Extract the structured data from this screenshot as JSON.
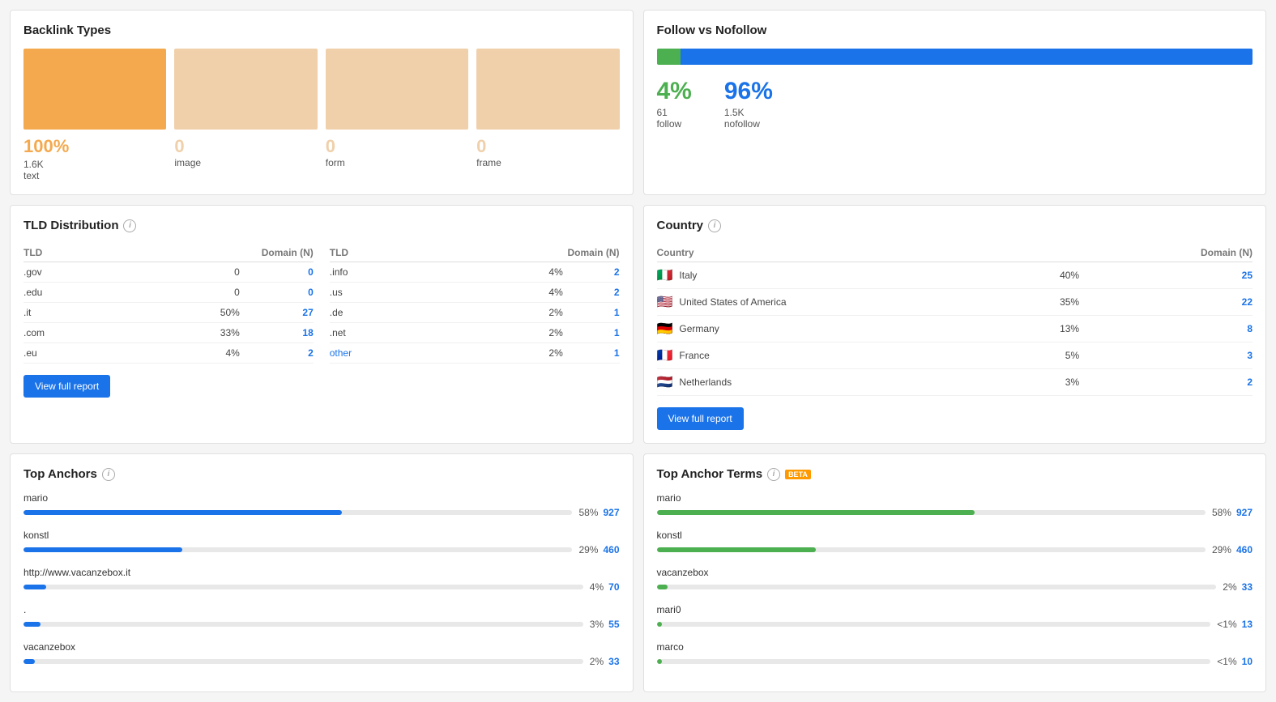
{
  "backlink_types": {
    "title": "Backlink Types",
    "items": [
      {
        "percent": "100%",
        "count": "1.6K",
        "label": "text",
        "color": "#f4a94e",
        "swatch_color": "#f4a94e"
      },
      {
        "percent": "0",
        "count": "",
        "label": "image",
        "color": "#f0d0aa",
        "swatch_color": "#f0d0aa"
      },
      {
        "percent": "0",
        "count": "",
        "label": "form",
        "color": "#f0d0aa",
        "swatch_color": "#f0d0aa"
      },
      {
        "percent": "0",
        "count": "",
        "label": "frame",
        "color": "#f0d0aa",
        "swatch_color": "#f0d0aa"
      }
    ]
  },
  "follow_nofollow": {
    "title": "Follow vs Nofollow",
    "follow_pct": 4,
    "nofollow_pct": 96,
    "follow_label": "4%",
    "nofollow_label": "96%",
    "follow_count": "61",
    "follow_name": "follow",
    "nofollow_count": "1.5K",
    "nofollow_name": "nofollow"
  },
  "tld": {
    "title": "TLD Distribution",
    "col1_header_tld": "TLD",
    "col1_header_domain": "Domain (N)",
    "col2_header_tld": "TLD",
    "col2_header_domain": "Domain (N)",
    "left_rows": [
      {
        "tld": ".gov",
        "pct": "0",
        "n": "0"
      },
      {
        "tld": ".edu",
        "pct": "0",
        "n": "0"
      },
      {
        "tld": ".it",
        "pct": "50%",
        "n": "27"
      },
      {
        "tld": ".com",
        "pct": "33%",
        "n": "18"
      },
      {
        "tld": ".eu",
        "pct": "4%",
        "n": "2"
      }
    ],
    "right_rows": [
      {
        "tld": ".info",
        "pct": "4%",
        "n": "2"
      },
      {
        "tld": ".us",
        "pct": "4%",
        "n": "2"
      },
      {
        "tld": ".de",
        "pct": "2%",
        "n": "1"
      },
      {
        "tld": ".net",
        "pct": "2%",
        "n": "1"
      },
      {
        "tld": "other",
        "pct": "2%",
        "n": "1"
      }
    ],
    "btn_label": "View full report"
  },
  "country": {
    "title": "Country",
    "header_country": "Country",
    "header_domain": "Domain (N)",
    "rows": [
      {
        "flag": "🇮🇹",
        "name": "Italy",
        "pct": "40%",
        "n": "25"
      },
      {
        "flag": "🇺🇸",
        "name": "United States of America",
        "pct": "35%",
        "n": "22"
      },
      {
        "flag": "🇩🇪",
        "name": "Germany",
        "pct": "13%",
        "n": "8"
      },
      {
        "flag": "🇫🇷",
        "name": "France",
        "pct": "5%",
        "n": "3"
      },
      {
        "flag": "🇳🇱",
        "name": "Netherlands",
        "pct": "3%",
        "n": "2"
      }
    ],
    "btn_label": "View full report"
  },
  "top_anchors": {
    "title": "Top Anchors",
    "items": [
      {
        "label": "mario",
        "pct": 58,
        "pct_label": "58%",
        "count": "927"
      },
      {
        "label": "konstl",
        "pct": 29,
        "pct_label": "29%",
        "count": "460"
      },
      {
        "label": "http://www.vacanzebox.it",
        "pct": 4,
        "pct_label": "4%",
        "count": "70"
      },
      {
        "label": ".",
        "pct": 3,
        "pct_label": "3%",
        "count": "55"
      },
      {
        "label": "vacanzebox",
        "pct": 2,
        "pct_label": "2%",
        "count": "33"
      }
    ]
  },
  "top_anchor_terms": {
    "title": "Top Anchor Terms",
    "beta": "BETA",
    "items": [
      {
        "label": "mario",
        "pct": 58,
        "pct_label": "58%",
        "count": "927"
      },
      {
        "label": "konstl",
        "pct": 29,
        "pct_label": "29%",
        "count": "460"
      },
      {
        "label": "vacanzebox",
        "pct": 2,
        "pct_label": "2%",
        "count": "33"
      },
      {
        "label": "mari0",
        "pct": 1,
        "pct_label": "<1%",
        "count": "13"
      },
      {
        "label": "marco",
        "pct": 1,
        "pct_label": "<1%",
        "count": "10"
      }
    ]
  }
}
